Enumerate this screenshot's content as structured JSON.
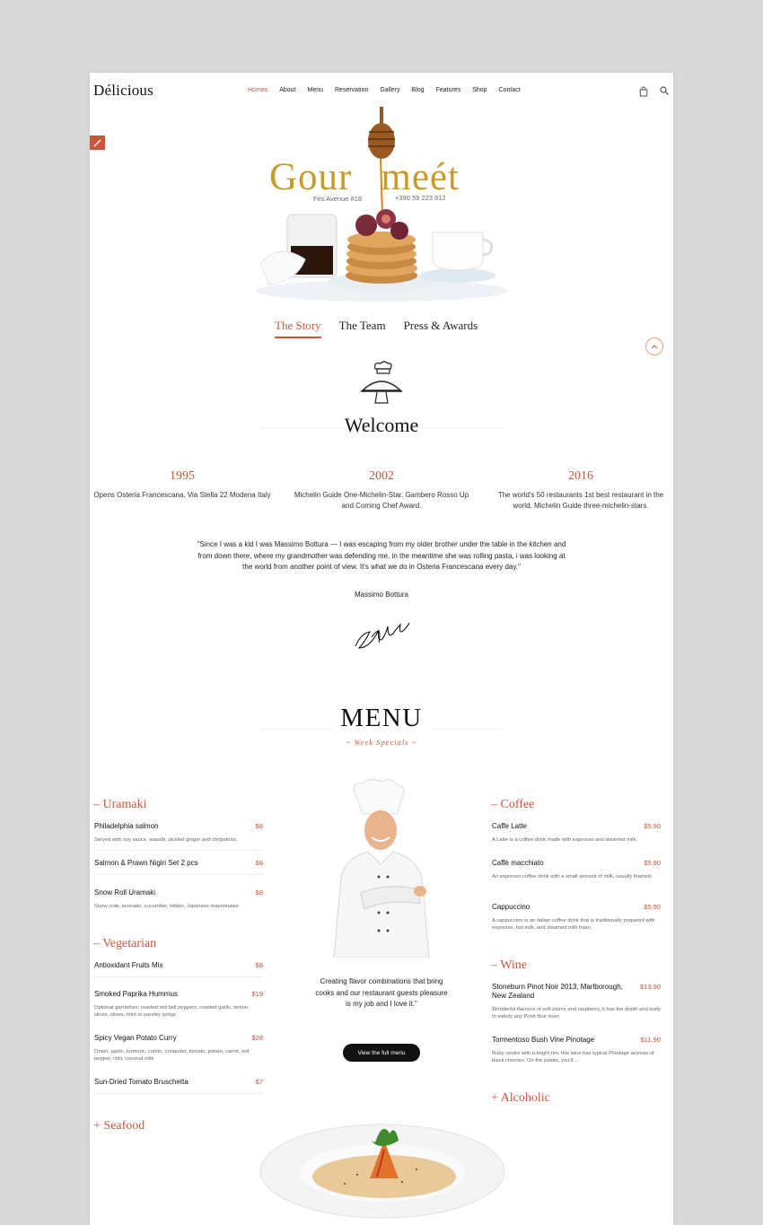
{
  "header": {
    "logo": "Délicious",
    "nav": [
      "Homes",
      "About",
      "Menu",
      "Reservation",
      "Gallery",
      "Blog",
      "Features",
      "Shop",
      "Contact"
    ],
    "active_nav": "Homes"
  },
  "hero": {
    "title_left": "Gour",
    "title_right": "meét",
    "address": "Firs Avenue #18",
    "phone": "+390 59 223 912"
  },
  "tabs": [
    "The Story",
    "The Team",
    "Press & Awards"
  ],
  "welcome": {
    "title": "Welcome",
    "milestones": [
      {
        "year": "1995",
        "text": "Opens Osteria Francescana, Via Stella 22 Modena Italy"
      },
      {
        "year": "2002",
        "text": "Michelin Guide One-Michelin-Star. Gambero Rosso Up and Coming Chef Award."
      },
      {
        "year": "2016",
        "text": "The world's 50 restaurants 1st best restaurant in the world. Michelin Guide three-michelin-stars."
      }
    ],
    "quote": "\"Since I was a kid I was Massimo Bottura — I was escaping from my older brother under the table in the kitchen and from down there, where my grandmother was defending me, in the meantime she was rolling pasta, i was looking at the world from another point of view. It's what we do in Osteria Francescana every day.\"",
    "author": "Massimo Bottura"
  },
  "menu": {
    "title": "MENU",
    "subtitle": "~ Week Specials ~",
    "left": [
      {
        "category": "– Uramaki",
        "items": [
          {
            "name": "Philadelphia salmon",
            "price": "$8",
            "desc": "Served with soy sauce, wasabi, pickled ginger and chopsticks."
          },
          {
            "name": "Salmon & Prawn Nigiri Set 2 pcs",
            "price": "$8",
            "desc": ""
          },
          {
            "name": "Snow Roll Uramaki",
            "price": "$8",
            "desc": "Snow crab, avocado, cucumber, tobiko, Japanese mayonnaise"
          }
        ]
      },
      {
        "category": "– Vegetarian",
        "items": [
          {
            "name": "Antioxidant Fruits Mix",
            "price": "$8",
            "desc": ""
          },
          {
            "name": "Smoked Paprika Hummus",
            "price": "$19",
            "desc": "Optional garnishes: roasted red bell peppers, roasted garlic, lemon slices, olives, mint or parsley sprigs"
          },
          {
            "name": "Spicy Vegan Potato Curry",
            "price": "$28",
            "desc": "Onion, garlic, turmeric, cumin, coriander, tomato, potato, carrot, red pepper, chili, coconut milk"
          },
          {
            "name": "Sun-Dried Tomato Bruschetta",
            "price": "$7",
            "desc": ""
          }
        ]
      },
      {
        "category": "+ Seafood",
        "items": []
      }
    ],
    "right": [
      {
        "category": "– Coffee",
        "items": [
          {
            "name": "Caffe Latte",
            "price": "$5.90",
            "desc": "A Latte is a coffee drink made with espresso and steamed milk."
          },
          {
            "name": "Caffè macchiato",
            "price": "$5.90",
            "desc": "An espresso coffee drink with a small amount of milk, usually foamed."
          },
          {
            "name": "Cappuccino",
            "price": "$5.90",
            "desc": "A cappuccino is an Italian coffee drink that is traditionally prepared with espresso, hot milk, and steamed milk foam."
          }
        ]
      },
      {
        "category": "– Wine",
        "items": [
          {
            "name": "Stoneburn Pinot Noir 2013, Marlborough, New Zealand",
            "price": "$13.90",
            "desc": "Wonderful flavours of soft plums and raspberry, it has the depth and body to satisfy any Pinot Noir lover."
          },
          {
            "name": "Tormentoso Bush Vine Pinotage",
            "price": "$11.90",
            "desc": "Ruby centre with a bright rim, this wine has typical Pinotage aromas of black cherries. On the palate, you'll ..."
          }
        ]
      },
      {
        "category": "+ Alcoholic",
        "items": []
      }
    ],
    "chef_text": "Creating flavor combinations that bring cooks and our restaurant guests pleasure is my job and I love it.\"",
    "full_menu_label": "View the full menu"
  },
  "colors": {
    "accent": "#c8573a",
    "gold": "#c99a2e"
  }
}
